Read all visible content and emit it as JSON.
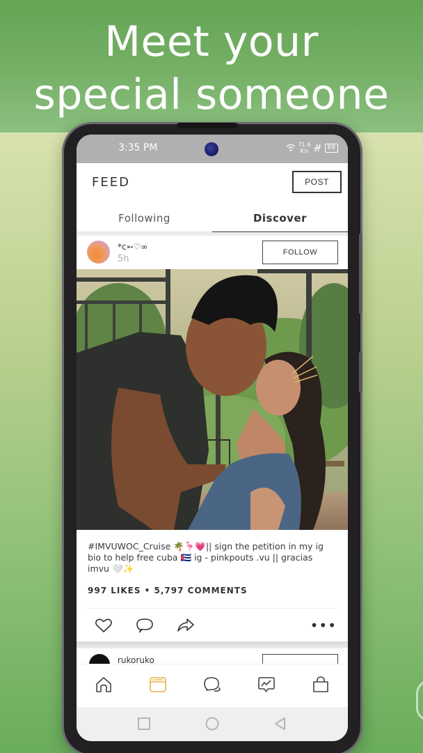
{
  "promo": {
    "headline_line1": "Meet your",
    "headline_line2": "special someone"
  },
  "status_bar": {
    "time": "3:35 PM",
    "net_speed_value": "71.6",
    "net_speed_unit": "K/s",
    "signal": "4G",
    "battery": "69"
  },
  "app_bar": {
    "title": "FEED",
    "post_button": "POST"
  },
  "tabs": [
    {
      "label": "Following",
      "active": false
    },
    {
      "label": "Discover",
      "active": true
    }
  ],
  "post": {
    "username": "*c➳♡∞",
    "time": "5h",
    "follow_button": "FOLLOW",
    "image_alt": "Two 3D avatars in an intimate pose inside a glass pavilion surrounded by trees",
    "caption_line1": "#IMVUWOC_Cruise 🌴🦩💗|| sign the petition in my ig",
    "caption_line2": "bio to help free cuba 🇨🇺 ig - pinkpouts .vu || gracias",
    "caption_line3": "imvu 🤍✨",
    "stats": "997 LIKES • 5,797 COMMENTS",
    "actions": [
      "heart-icon",
      "comment-icon",
      "share-icon",
      "more-icon"
    ]
  },
  "next_post": {
    "username": "rukoruko"
  },
  "bottom_nav": [
    {
      "name": "home",
      "active": false
    },
    {
      "name": "feed",
      "active": true
    },
    {
      "name": "chat",
      "active": false
    },
    {
      "name": "activity",
      "active": false
    },
    {
      "name": "shop",
      "active": false
    }
  ],
  "colors": {
    "accent": "#e8b24a",
    "green_banner": "#64a555",
    "status_bar": "#b0b0b0"
  }
}
